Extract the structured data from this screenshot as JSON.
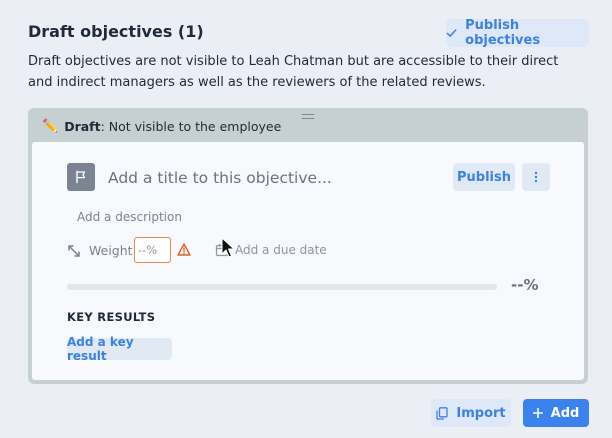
{
  "header": {
    "title": "Draft objectives (1)",
    "publish_button": "Publish objectives",
    "description": "Draft objectives are not visible to Leah Chatman but are accessible to their direct and indirect managers as well as the reviewers of the related reviews."
  },
  "draft_card": {
    "banner_bold": "Draft",
    "banner_rest": ": Not visible to the employee",
    "banner_icon": "pencil-icon",
    "objective": {
      "title_placeholder": "Add a title to this objective...",
      "publish_label": "Publish",
      "description_placeholder": "Add a description",
      "weight_label": "Weight:",
      "weight_placeholder": "--%",
      "due_date_label": "Add a due date",
      "progress_value": 0,
      "progress_text": "--%",
      "key_results_title": "KEY RESULTS",
      "add_key_result_label": "Add a key result"
    }
  },
  "footer": {
    "import_label": "Import",
    "add_label": "Add"
  },
  "colors": {
    "accent": "#3c82e0",
    "primary_button": "#3a82ee",
    "warning": "#e2602a",
    "draft_banner_bg": "#c6d0d3"
  }
}
